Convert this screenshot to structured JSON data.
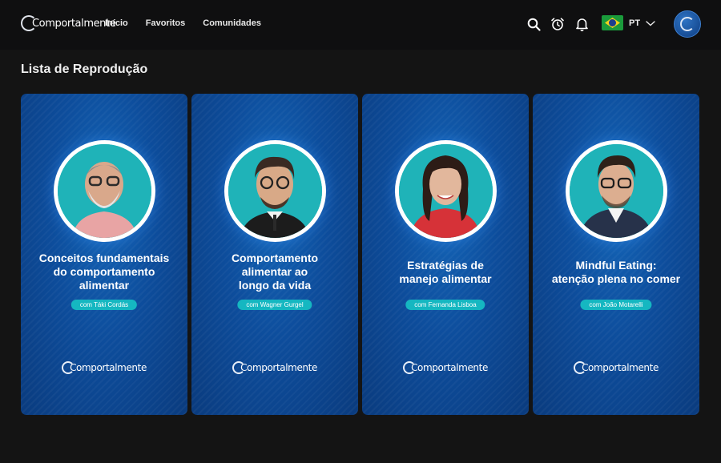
{
  "header": {
    "brand": "Comportalmente",
    "nav": [
      "Início",
      "Favoritos",
      "Comunidades"
    ],
    "icons": [
      "search-icon",
      "alarm-clock-icon",
      "bell-icon"
    ],
    "language": {
      "code": "PT",
      "flag": "brazil-flag-icon"
    },
    "avatar_icon": "brand-c-icon"
  },
  "page": {
    "title": "Lista de Reprodução"
  },
  "cards": [
    {
      "title_lines": [
        "Conceitos fundamentais",
        "do comportamento",
        "alimentar"
      ],
      "presenter": "com Táki Cordás",
      "logo": "Comportalmente"
    },
    {
      "title_lines": [
        "Comportamento",
        "alimentar ao",
        "longo da vida"
      ],
      "presenter": "com Wagner Gurgel",
      "logo": "Comportalmente"
    },
    {
      "title_lines": [
        "Estratégias de",
        "manejo alimentar"
      ],
      "presenter": "com Fernanda Lisboa",
      "logo": "Comportalmente"
    },
    {
      "title_lines": [
        "Mindful Eating:",
        "atenção plena no comer"
      ],
      "presenter": "com João Motarelli",
      "logo": "Comportalmente"
    }
  ],
  "colors": {
    "background": "#141414",
    "topbar": "#0f0f10",
    "card_blue": "#0d4d9c",
    "pill_teal": "#15b7c1",
    "photo_teal": "#1fb3b8"
  }
}
